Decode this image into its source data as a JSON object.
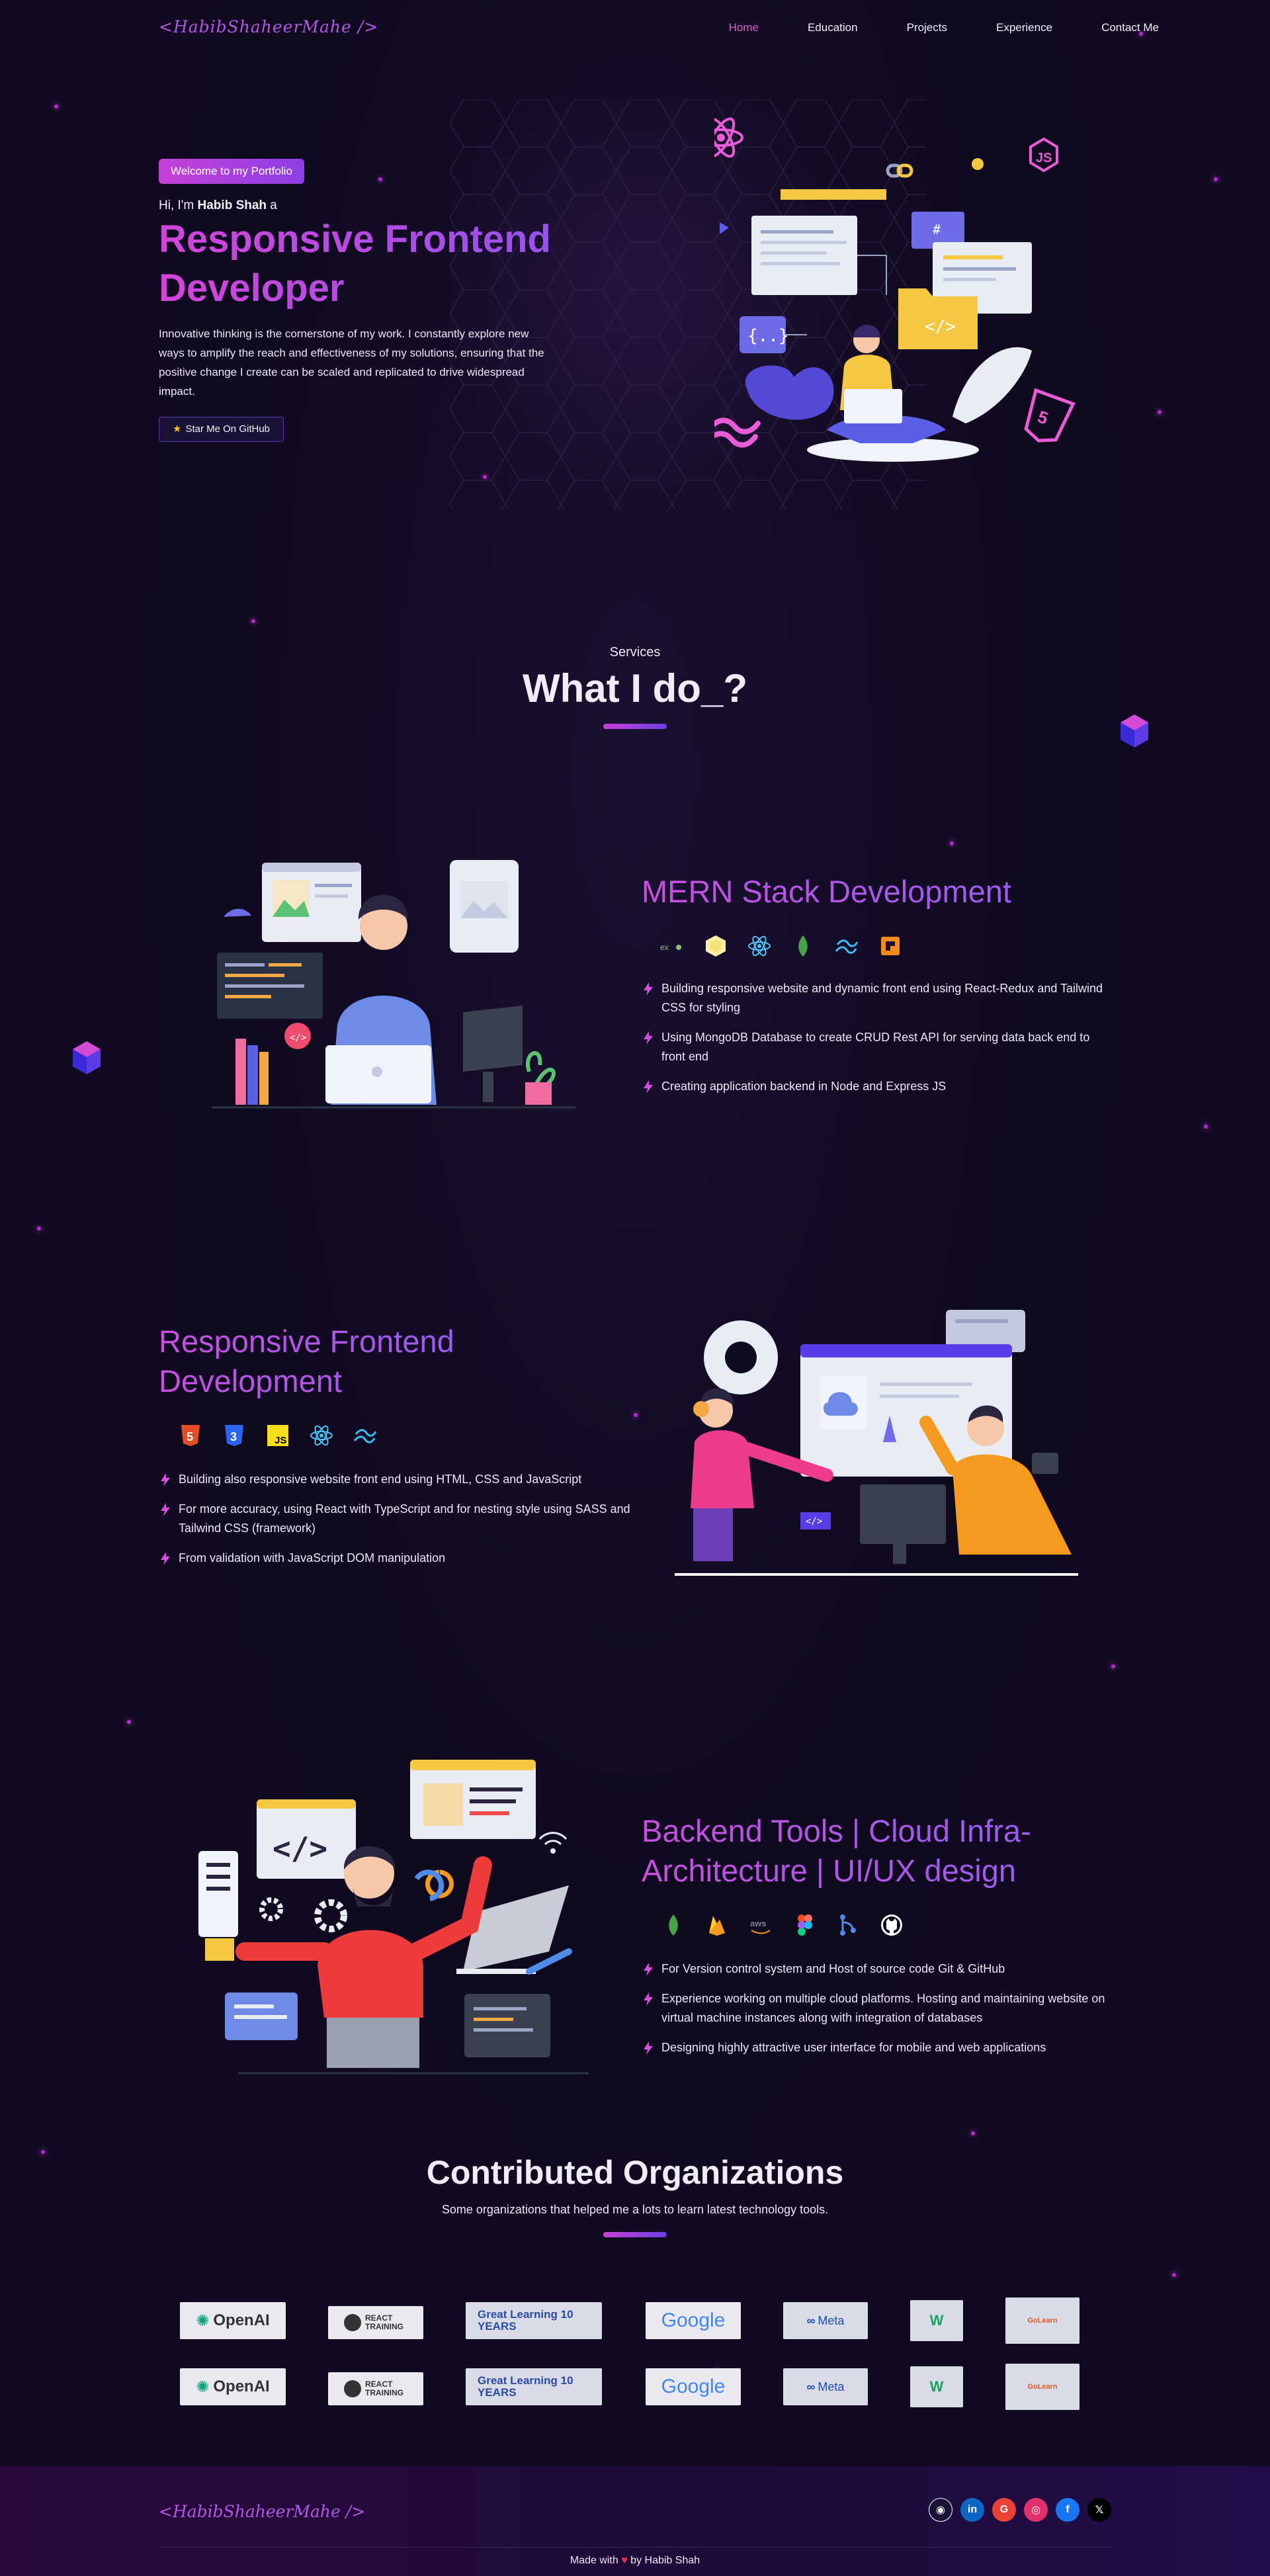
{
  "nav": {
    "logo": "<HabibShaheerMahe />",
    "links": [
      {
        "label": "Home",
        "active": true
      },
      {
        "label": "Education",
        "active": false
      },
      {
        "label": "Projects",
        "active": false
      },
      {
        "label": "Experience",
        "active": false
      },
      {
        "label": "Contact Me",
        "active": false
      }
    ]
  },
  "hero": {
    "badge": "Welcome to my Portfolio",
    "greeting_prefix": "Hi, I'm ",
    "name": "Habib Shah",
    "greeting_suffix": " a",
    "title_line1": "Responsive Frontend",
    "title_line2": "Developer",
    "description": "Innovative thinking is the cornerstone of my work. I constantly explore new ways to amplify the reach and effectiveness of my solutions, ensuring that the positive change I create can be scaled and replicated to drive widespread impact.",
    "github_button": "Star Me On GitHub",
    "icons": [
      "react-icon",
      "js-icon",
      "tailwind-icon",
      "html5-icon"
    ]
  },
  "services": {
    "subtitle": "Services",
    "title": "What I do_?",
    "items": [
      {
        "title": "MERN Stack Development",
        "techs": [
          "express-icon",
          "nodejs-icon",
          "react-icon",
          "mongodb-icon",
          "tailwind-icon",
          "aws-icon"
        ],
        "bullets": [
          "Building responsive website and dynamic front end using React-Redux and Tailwind CSS for styling",
          "Using MongoDB Database to create CRUD Rest API for serving data back end to front end",
          "Creating application backend in Node and Express JS"
        ]
      },
      {
        "title_line1": "Responsive Frontend",
        "title_line2": "Development",
        "techs": [
          "html5-icon",
          "css3-icon",
          "javascript-icon",
          "react-icon",
          "tailwind-icon"
        ],
        "bullets": [
          "Building also responsive website front end using HTML, CSS and JavaScript",
          "For more accuracy, using React with TypeScript and for nesting style using SASS and Tailwind CSS (framework)",
          "From validation with JavaScript DOM manipulation"
        ]
      },
      {
        "title_line1": "Backend Tools | Cloud Infra-",
        "title_line2": "Architecture | UI/UX design",
        "techs": [
          "mongodb-icon",
          "firebase-icon",
          "aws-icon",
          "figma-icon",
          "git-icon",
          "github-icon"
        ],
        "bullets": [
          "For Version control system and Host of source code Git & GitHub",
          "Experience working on multiple cloud platforms. Hosting and maintaining website on virtual machine instances along with integration of databases",
          "Designing highly attractive user interface for mobile and web applications"
        ]
      }
    ]
  },
  "organizations": {
    "title": "Contributed Organizations",
    "subtitle": "Some organizations that helped me a lots to learn latest technology tools.",
    "logos": [
      "OpenAI",
      "REACT TRAINING",
      "Great Learning 10 YEARS",
      "Google",
      "Meta",
      "W",
      "GoLearn"
    ]
  },
  "footer": {
    "logo": "<HabibShaheerMahe />",
    "socials": [
      "github-icon",
      "linkedin-icon",
      "google-icon",
      "instagram-icon",
      "facebook-icon",
      "x-icon"
    ],
    "made_prefix": "Made with",
    "made_suffix": "by Habib Shah"
  },
  "colors": {
    "accent_pink": "#d344d9",
    "accent_purple": "#8d54ee",
    "background": "#100a1f"
  }
}
